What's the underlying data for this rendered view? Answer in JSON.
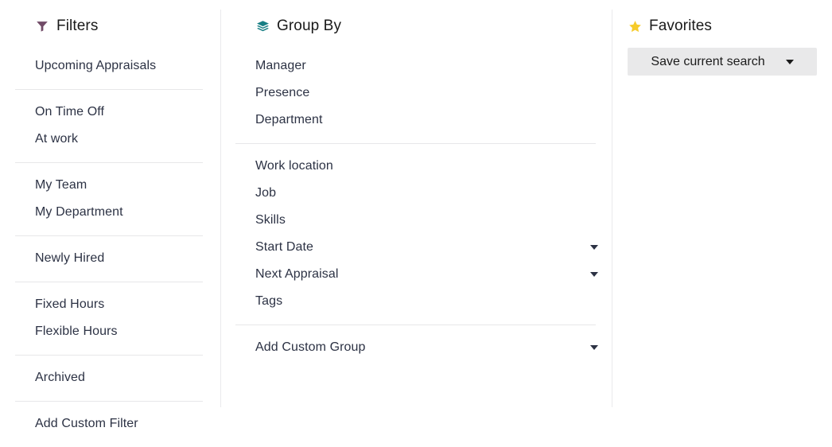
{
  "panel": {
    "columns": [
      {
        "key": "filters",
        "title": "Filters",
        "icon": "funnel-icon",
        "icon_color": "#714B67",
        "groups": [
          {
            "items": [
              {
                "label": "Upcoming Appraisals",
                "caret": false
              }
            ]
          },
          {
            "items": [
              {
                "label": "On Time Off",
                "caret": false
              },
              {
                "label": "At work",
                "caret": false
              }
            ]
          },
          {
            "items": [
              {
                "label": "My Team",
                "caret": false
              },
              {
                "label": "My Department",
                "caret": false
              }
            ]
          },
          {
            "items": [
              {
                "label": "Newly Hired",
                "caret": false
              }
            ]
          },
          {
            "items": [
              {
                "label": "Fixed Hours",
                "caret": false
              },
              {
                "label": "Flexible Hours",
                "caret": false
              }
            ]
          },
          {
            "items": [
              {
                "label": "Archived",
                "caret": false
              }
            ]
          },
          {
            "items": [
              {
                "label": "Add Custom Filter",
                "caret": false
              }
            ]
          }
        ]
      },
      {
        "key": "group_by",
        "title": "Group By",
        "icon": "layers-icon",
        "icon_color": "#177E84",
        "groups": [
          {
            "items": [
              {
                "label": "Manager",
                "caret": false
              },
              {
                "label": "Presence",
                "caret": false
              },
              {
                "label": "Department",
                "caret": false
              }
            ]
          },
          {
            "items": [
              {
                "label": "Work location",
                "caret": false
              },
              {
                "label": "Job",
                "caret": false
              },
              {
                "label": "Skills",
                "caret": false
              },
              {
                "label": "Start Date",
                "caret": true
              },
              {
                "label": "Next Appraisal",
                "caret": true
              },
              {
                "label": "Tags",
                "caret": false
              }
            ]
          },
          {
            "items": [
              {
                "label": "Add Custom Group",
                "caret": true
              }
            ]
          }
        ]
      },
      {
        "key": "favorites",
        "title": "Favorites",
        "icon": "star-icon",
        "icon_color": "#F6CB2B",
        "groups": [],
        "save_search_label": "Save current search"
      }
    ]
  },
  "colors": {
    "text": "#2c3244",
    "heading": "#1a1a1a",
    "divider": "#e7e7e9",
    "column_divider": "#eaeaec",
    "button_bg": "#e9e9ea"
  }
}
